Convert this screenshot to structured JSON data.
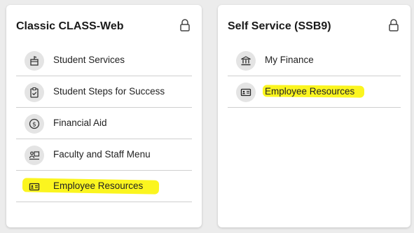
{
  "cards": [
    {
      "title": "Classic CLASS-Web",
      "lock_icon": "lock-icon",
      "items": [
        {
          "label": "Student Services",
          "icon": "student-services-icon"
        },
        {
          "label": "Student Steps for Success",
          "icon": "clipboard-check-icon"
        },
        {
          "label": "Financial Aid",
          "icon": "dollar-circle-icon"
        },
        {
          "label": "Faculty and Staff Menu",
          "icon": "presentation-icon"
        },
        {
          "label": "Employee Resources",
          "icon": "id-card-icon",
          "highlighted": true
        }
      ]
    },
    {
      "title": "Self Service (SSB9)",
      "lock_icon": "lock-icon",
      "items": [
        {
          "label": "My Finance",
          "icon": "bank-icon"
        },
        {
          "label": "Employee Resources",
          "icon": "id-card-icon",
          "highlighted": true
        }
      ]
    }
  ],
  "colors": {
    "highlight": "#fbf51f",
    "background": "#ececec",
    "card": "#ffffff",
    "icon_circle": "#e4e4e4"
  }
}
